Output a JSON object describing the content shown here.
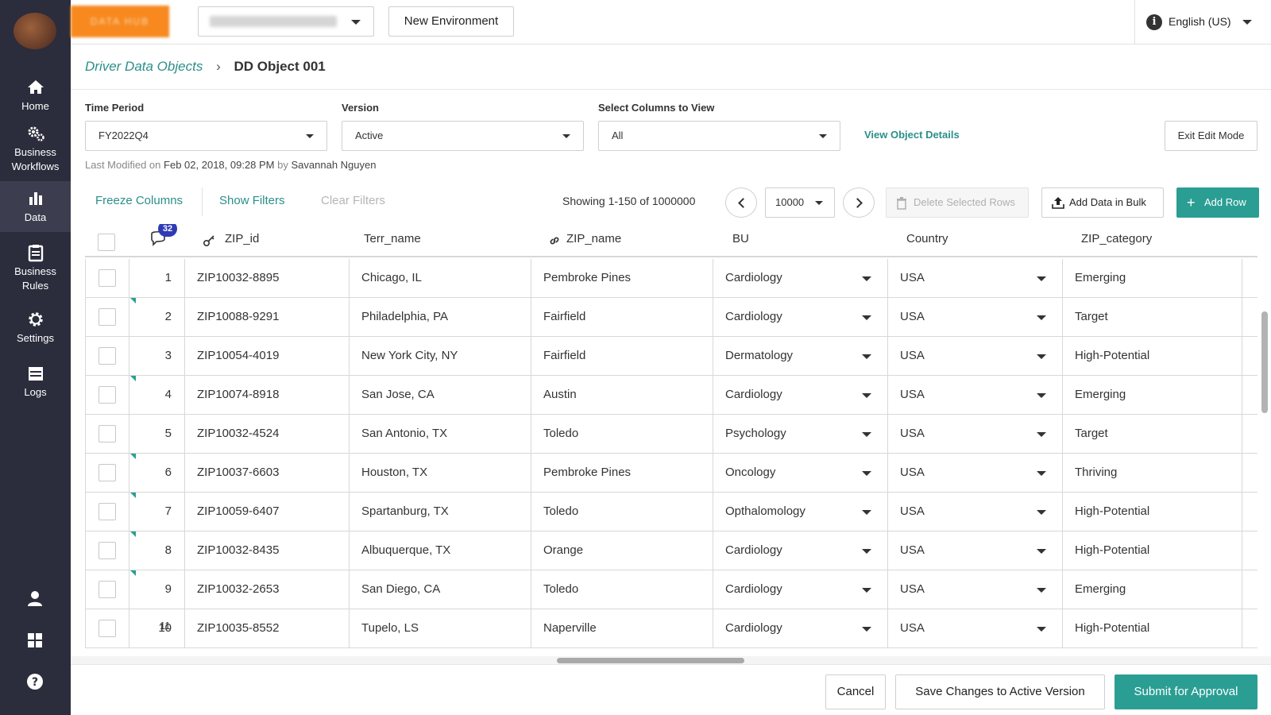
{
  "sidebar": {
    "items": [
      {
        "label": "Home",
        "icon": "home-icon"
      },
      {
        "label": "Business Workflows",
        "icon": "gears-icon"
      },
      {
        "label": "Data",
        "icon": "bar-chart-icon",
        "active": true
      },
      {
        "label": "Business Rules",
        "icon": "clipboard-icon"
      },
      {
        "label": "Settings",
        "icon": "gear-icon"
      },
      {
        "label": "Logs",
        "icon": "logs-icon"
      }
    ],
    "bottom_icons": [
      "user-icon",
      "apps-grid-icon",
      "help-icon"
    ]
  },
  "topbar": {
    "new_environment_label": "New Environment",
    "language_label": "English (US)"
  },
  "breadcrumb": {
    "parent": "Driver Data Objects",
    "current": "DD Object 001"
  },
  "filters": {
    "time_period_label": "Time Period",
    "time_period_value": "FY2022Q4",
    "version_label": "Version",
    "version_value": "Active",
    "columns_label": "Select Columns to View",
    "columns_value": "All",
    "view_details_label": "View Object Details",
    "exit_edit_label": "Exit Edit Mode"
  },
  "last_modified": {
    "prefix": "Last Modified on",
    "date": "Feb 02, 2018, 09:28 PM",
    "by": "by",
    "user": "Savannah Nguyen"
  },
  "toolbar": {
    "freeze_columns": "Freeze Columns",
    "show_filters": "Show Filters",
    "clear_filters": "Clear Filters",
    "showing": "Showing 1-150 of 1000000",
    "page_size": "10000",
    "delete_rows": "Delete Selected Rows",
    "add_bulk": "Add Data in Bulk",
    "add_row": "Add Row"
  },
  "table": {
    "comment_count": "32",
    "columns": [
      "ZIP_id",
      "Terr_name",
      "ZIP_name",
      "BU",
      "Country",
      "ZIP_category"
    ],
    "rows": [
      {
        "n": "1",
        "zip_id": "ZIP10032-8895",
        "terr": "Chicago, IL",
        "zip_name": "Pembroke Pines",
        "bu": "Cardiology",
        "country": "USA",
        "category": "Emerging"
      },
      {
        "n": "2",
        "zip_id": "ZIP10088-9291",
        "terr": "Philadelphia, PA",
        "zip_name": "Fairfield",
        "bu": "Cardiology",
        "country": "USA",
        "category": "Target"
      },
      {
        "n": "3",
        "zip_id": "ZIP10054-4019",
        "terr": "New York City, NY",
        "zip_name": "Fairfield",
        "bu": "Dermatology",
        "country": "USA",
        "category": "High-Potential"
      },
      {
        "n": "4",
        "zip_id": "ZIP10074-8918",
        "terr": "San Jose, CA",
        "zip_name": "Austin",
        "bu": "Cardiology",
        "country": "USA",
        "category": "Emerging"
      },
      {
        "n": "5",
        "zip_id": "ZIP10032-4524",
        "terr": "San Antonio, TX",
        "zip_name": "Toledo",
        "bu": "Psychology",
        "country": "USA",
        "category": "Target"
      },
      {
        "n": "6",
        "zip_id": "ZIP10037-6603",
        "terr": "Houston, TX",
        "zip_name": "Pembroke Pines",
        "bu": "Oncology",
        "country": "USA",
        "category": "Thriving"
      },
      {
        "n": "7",
        "zip_id": "ZIP10059-6407",
        "terr": "Spartanburg, TX",
        "zip_name": "Toledo",
        "bu": "Opthalomology",
        "country": "USA",
        "category": "High-Potential"
      },
      {
        "n": "8",
        "zip_id": "ZIP10032-8435",
        "terr": "Albuquerque, TX",
        "zip_name": "Orange",
        "bu": "Cardiology",
        "country": "USA",
        "category": "High-Potential"
      },
      {
        "n": "9",
        "zip_id": "ZIP10032-2653",
        "terr": "San Diego, CA",
        "zip_name": "Toledo",
        "bu": "Cardiology",
        "country": "USA",
        "category": "Emerging"
      },
      {
        "n": "10",
        "zip_id": "ZIP10035-8552",
        "terr": "Tupelo, LS",
        "zip_name": "Naperville",
        "bu": "Cardiology",
        "country": "USA",
        "category": "High-Potential"
      }
    ],
    "partial_row_number": "11"
  },
  "footer": {
    "cancel": "Cancel",
    "save": "Save Changes to Active Version",
    "submit": "Submit for Approval"
  },
  "colors": {
    "sidebar_bg": "#2b2c3c",
    "brand_orange": "#f7891f",
    "accent_teal": "#2b9e94",
    "badge_blue": "#2f3bb5"
  }
}
